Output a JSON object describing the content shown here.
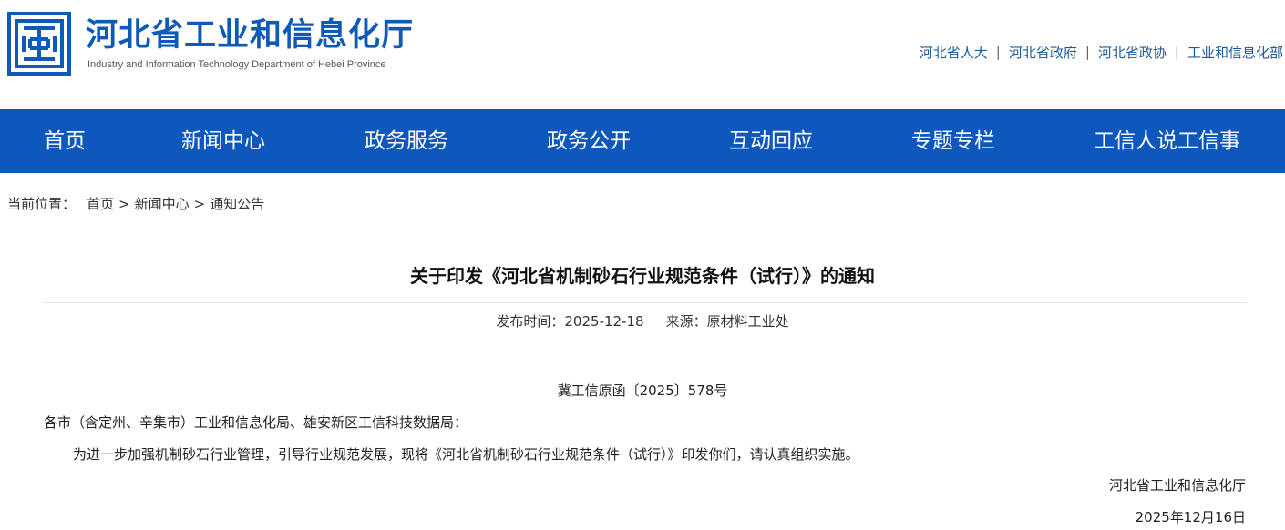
{
  "site": {
    "name_cn": "河北省工业和信息化厅",
    "name_en": "Industry and Information Technology Department of Hebei Province",
    "logo_icon": "hebei-emblem-icon",
    "brand_color": "#0e5ab8"
  },
  "top_links": [
    {
      "label": "河北省人大"
    },
    {
      "label": "河北省政府"
    },
    {
      "label": "河北省政协"
    },
    {
      "label": "工业和信息化部"
    }
  ],
  "top_link_separator": "|",
  "nav": {
    "bg_color": "#0e58bd",
    "items": [
      {
        "label": "首页"
      },
      {
        "label": "新闻中心"
      },
      {
        "label": "政务服务"
      },
      {
        "label": "政务公开"
      },
      {
        "label": "互动回应"
      },
      {
        "label": "专题专栏"
      },
      {
        "label": "工信人说工信事"
      }
    ]
  },
  "breadcrumb": {
    "label": "当前位置：",
    "separator": ">",
    "items": [
      "首页",
      "新闻中心",
      "通知公告"
    ]
  },
  "article": {
    "title": "关于印发《河北省机制砂石行业规范条件（试行）》的通知",
    "publish_label": "发布时间：",
    "publish_date": "2025-12-18",
    "source_label": "来源：",
    "source": "原材料工业处",
    "doc_number": "冀工信原函〔2025〕578号",
    "recipients": "各市（含定州、辛集市）工业和信息化局、雄安新区工信科技数据局：",
    "body": "为进一步加强机制砂石行业管理，引导行业规范发展，现将《河北省机制砂石行业规范条件（试行）》印发你们，请认真组织实施。",
    "signature": "河北省工业和信息化厅",
    "sign_date": "2025年12月16日"
  }
}
